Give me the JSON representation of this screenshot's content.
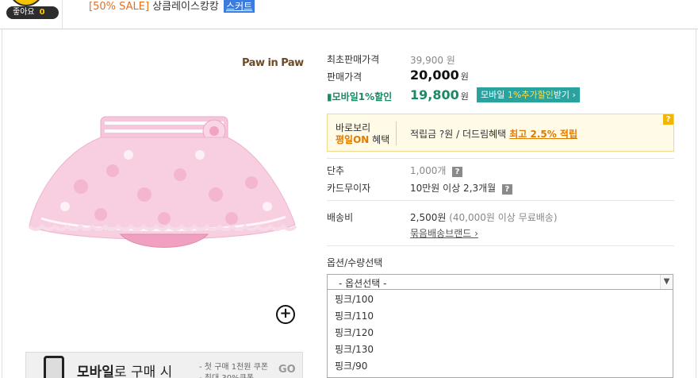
{
  "header": {
    "like_label": "좋아요",
    "like_count": "0",
    "title_sale": "[50% SALE]",
    "title_name": "상큼레이스캉캉",
    "title_category": "스커트"
  },
  "product": {
    "brand": "Paw in Paw",
    "zoom_icon": "plus-circle-icon"
  },
  "prices": {
    "orig_label": "최초판매가격",
    "orig_value": "39,900 원",
    "sale_label": "판매가격",
    "sale_value": "20,000",
    "sale_unit": "원",
    "mobile_label": "모바일1%할인",
    "mobile_value": "19,800",
    "mobile_unit": "원",
    "mobile_btn_pre": "모바일",
    "mobile_btn_hl": "1%추가할인",
    "mobile_btn_post": "받기 ›"
  },
  "promo": {
    "line1": "바로보리",
    "line2_on": "평일ON",
    "line2_post": "혜택",
    "text": "적립금 ?원 / 더드림혜택",
    "link": "최고 2.5% 적립",
    "help": "?"
  },
  "info": {
    "step_label": "단추",
    "step_value": "1,000개",
    "card_label": "카드무이자",
    "card_value": "10만원 이상 2,3개월",
    "ship_label": "배송비",
    "ship_value": "2,500원",
    "ship_note": "(40,000원 이상 무료배송)",
    "ship_link": "묶음배송브랜드 ›"
  },
  "options": {
    "label": "옵션/수량선택",
    "selected": "- 옵션선택 -",
    "items": [
      "핑크/100",
      "핑크/110",
      "핑크/120",
      "핑크/130",
      "핑크/90"
    ]
  },
  "mobile_banner": {
    "title_bold": "모바일",
    "title_rest": "로 구매 시",
    "sub1": "- 첫 구매 1천원 쿠폰",
    "sub2": "- 최대 30%쿠폰",
    "go": "GO"
  },
  "colors": {
    "sale_orange": "#e4701e",
    "category_blue": "#3b7be0",
    "mobile_green": "#1a8a62",
    "mobile_button_teal": "#2aa3a0",
    "promo_orange": "#e07b00"
  }
}
